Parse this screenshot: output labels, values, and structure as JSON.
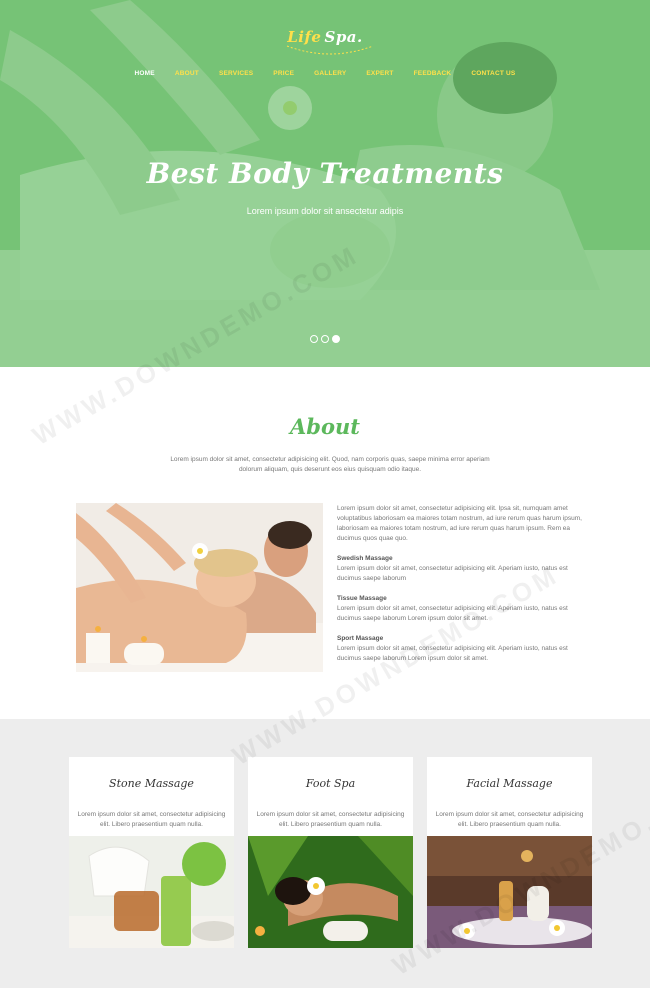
{
  "logo": {
    "main": "Life",
    "accent": "Spa."
  },
  "nav": {
    "items": [
      {
        "label": "HOME",
        "active": true
      },
      {
        "label": "ABOUT"
      },
      {
        "label": "SERVICES"
      },
      {
        "label": "PRICE"
      },
      {
        "label": "GALLERY"
      },
      {
        "label": "EXPERT"
      },
      {
        "label": "FEEDBACK"
      },
      {
        "label": "CONTACT US"
      }
    ]
  },
  "hero": {
    "title": "Best Body Treatments",
    "subtitle": "Lorem ipsum dolor sit ansectetur adipis",
    "slides_total": 3,
    "active_slide": 3
  },
  "about": {
    "title": "About",
    "intro": "Lorem ipsum dolor sit amet, consectetur adipisicing elit. Quod, nam corporis quas, saepe minima error aperiam dolorum aliquam, quis deserunt eos eius quisquam odio itaque.",
    "paragraph": "Lorem ipsum dolor sit amet, consectetur adipisicing elit. Ipsa sit, numquam amet voluptatibus laboriosam ea maiores totam nostrum, ad iure rerum quas harum ipsum, laboriosam ea maiores totam nostrum, ad iure rerum quas harum ipsum. Rem ea ducimus quos quae quo.",
    "items": [
      {
        "heading": "Swedish Massage",
        "text": "Lorem ipsum dolor sit amet, consectetur adipisicing elit. Aperiam iusto, natus est ducimus saepe laborum"
      },
      {
        "heading": "Tissue Massage",
        "text": "Lorem ipsum dolor sit amet, consectetur adipisicing elit. Aperiam iusto, natus est ducimus saepe laborum Lorem ipsum dolor sit amet."
      },
      {
        "heading": "Sport Massage",
        "text": "Lorem ipsum dolor sit amet, consectetur adipisicing elit. Aperiam iusto, natus est ducimus saepe laborum Lorem ipsum dolor sit amet."
      }
    ]
  },
  "services": {
    "cards": [
      {
        "title": "Stone Massage",
        "text": "Lorem ipsum dolor sit amet, consectetur adipisicing elit. Libero praesentium quam nulla."
      },
      {
        "title": "Foot Spa",
        "text": "Lorem ipsum dolor sit amet, consectetur adipisicing elit. Libero praesentium quam nulla."
      },
      {
        "title": "Facial Massage",
        "text": "Lorem ipsum dolor sit amet, consectetur adipisicing elit. Libero praesentium quam nulla."
      }
    ]
  },
  "watermark": "WWW.DOWNDEMO.COM",
  "colors": {
    "brand_green": "#5cb85c",
    "logo_yellow": "#ffe04a",
    "section_gray": "#ededed"
  }
}
